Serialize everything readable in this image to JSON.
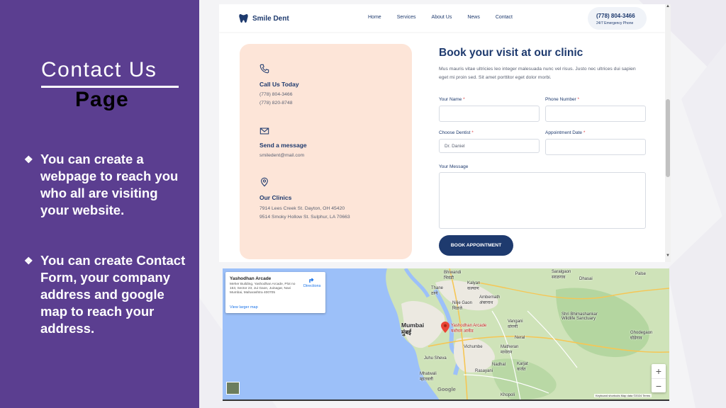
{
  "slide": {
    "title_line1": "Contact Us",
    "title_line2": "Page",
    "bullets": [
      "You can create a webpage to reach you who all are visiting your website.",
      "You can create Contact Form, your company address and google map to reach your address."
    ],
    "bullet_mark": "❖",
    "colors": {
      "panel": "#5b3e90",
      "text": "#ffffff"
    }
  },
  "site": {
    "brand": "Smile Dent",
    "nav": [
      "Home",
      "Services",
      "About Us",
      "News",
      "Contact"
    ],
    "phone": {
      "number": "(778) 804-3466",
      "sub": "24/7 Emergency Phone"
    },
    "info": {
      "call": {
        "heading": "Call Us Today",
        "lines": [
          "(778) 804-3466",
          "(778) 820-8748"
        ]
      },
      "message": {
        "heading": "Send a message",
        "lines": [
          "smiledent@mail.com"
        ]
      },
      "clinics": {
        "heading": "Our Clinics",
        "lines": [
          "7914 Lees Creek St. Dayton, OH 45420",
          "9514 Smoky Hollow St. Sulphur, LA 70663"
        ]
      }
    },
    "form": {
      "title": "Book your visit at our clinic",
      "description": "Mus mauris vitae ultricies leo integer malesuada nunc vel risus. Justo nec ultrices dui sapien eget mi proin sed. Sit amet porttitor eget dolor morbi.",
      "fields": {
        "name_label": "Your Name",
        "phone_label": "Phone Number",
        "dentist_label": "Choose Dentist",
        "dentist_value": "Dr. Daniel",
        "date_label": "Appointment Date",
        "message_label": "Your Message"
      },
      "required_mark": "*",
      "submit": "BOOK APPOINTMENT"
    },
    "colors": {
      "navy": "#1e3a6e",
      "peach": "#fde5d8"
    }
  },
  "map": {
    "place": {
      "title": "Yashodhan Arcade",
      "address": "Meher Building, Yashodhan Arcade, Plot no 153, Sector 23, Jui Gaon, Juinagar, Navi Mumbai, Maharashtra 400705",
      "directions": "Directions",
      "larger": "View larger map"
    },
    "labels": {
      "bhiwandi": "Bhiwandi",
      "bhiwandi_local": "भिवंडी",
      "kalyan": "Kalyan",
      "kalyan_local": "कल्याण",
      "thane": "Thane",
      "thane_local": "ठाणे",
      "ambernath": "Ambernath",
      "ambernath_local": "अंबरनाथ",
      "nilje": "Nilje Gaon",
      "nilje_local": "निळजे",
      "mumbai": "Mumbai",
      "mumbai_local": "मुंबई",
      "pin_label": "Yashodhan Arcade",
      "pin_label_local": "यशोधन आर्केड",
      "saralgaon": "Saralgaon",
      "saralgaon_local": "सरळगाव",
      "dhasai": "Dhasai",
      "vangani": "Vangani",
      "vangani_local": "वांगणी",
      "karjat": "Karjat",
      "karjat_local": "कर्जत",
      "matheran": "Matheran",
      "matheran_local": "माथेरान",
      "neral": "Neral",
      "vichumbe": "Vichumbe",
      "juhu": "Juhu Sheva",
      "mhatwali": "Mhatwali",
      "mhatwali_local": "म्हातवली",
      "nadhal": "Nadhal",
      "rasayani": "Rasayani",
      "khopoli": "Khopoli",
      "shri": "Shri Bhimashankar Wildlife Sanctuary",
      "ghodegaon": "Ghodegaon",
      "ghodegaon_local": "घोडेगाव",
      "palse": "Palse"
    },
    "zoom_in": "+",
    "zoom_out": "−",
    "google": "Google",
    "attribution": "Keyboard shortcuts   Map data ©2024   Terms"
  }
}
